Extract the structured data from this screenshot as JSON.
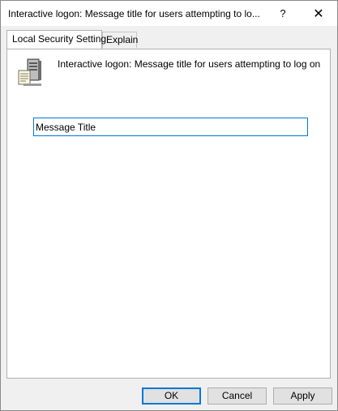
{
  "window": {
    "title": "Interactive logon: Message title for users attempting to lo...",
    "help_label": "?",
    "close_label": "✕"
  },
  "tabs": [
    {
      "label": "Local Security Setting",
      "active": true
    },
    {
      "label": "Explain",
      "active": false
    }
  ],
  "panel": {
    "icon": "server-icon",
    "description": "Interactive logon: Message title for users attempting to log on",
    "input_value": "Message Title"
  },
  "buttons": {
    "ok_label": "OK",
    "cancel_label": "Cancel",
    "apply_label": "Apply"
  },
  "colors": {
    "focus_accent": "#0078d7",
    "window_bg": "#f0f0f0",
    "panel_bg": "#ffffff"
  }
}
